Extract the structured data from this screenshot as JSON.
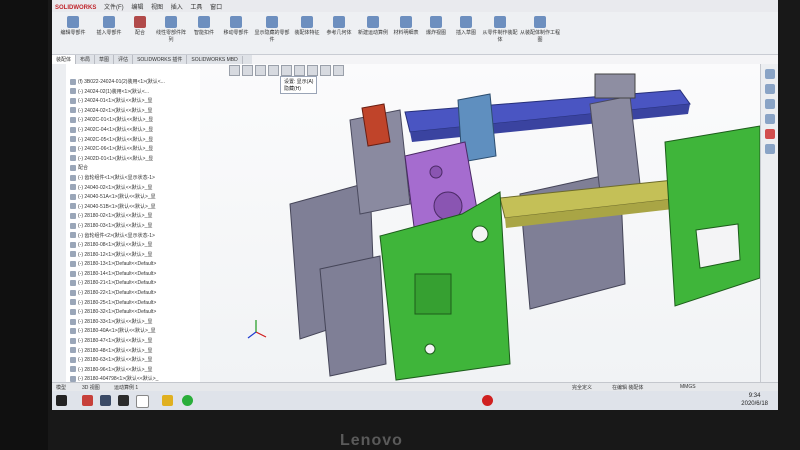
{
  "app": {
    "brand": "SOLIDWORKS",
    "menu": [
      "文件(F)",
      "编辑",
      "视图",
      "插入",
      "工具",
      "窗口"
    ]
  },
  "ribbon": {
    "groups": [
      {
        "label": "编辑零部件",
        "icon": "edit-component-icon"
      },
      {
        "label": "插入零部件",
        "icon": "insert-component-icon"
      },
      {
        "label": "配合",
        "icon": "mate-icon"
      },
      {
        "label": "线性零部件阵列",
        "icon": "pattern-icon"
      },
      {
        "label": "智能扣件",
        "icon": "fastener-icon"
      },
      {
        "label": "移动零部件",
        "icon": "move-component-icon"
      },
      {
        "label": "显示隐藏的零部件",
        "icon": "show-hidden-icon"
      },
      {
        "label": "装配体特征",
        "icon": "assembly-feature-icon"
      },
      {
        "label": "参考几何体",
        "icon": "reference-geometry-icon"
      },
      {
        "label": "新建运动算例",
        "icon": "motion-study-icon"
      },
      {
        "label": "材料明细表",
        "icon": "bom-icon"
      },
      {
        "label": "爆炸视图",
        "icon": "explode-icon"
      },
      {
        "label": "插入草图",
        "icon": "sketch-icon"
      },
      {
        "label": "从零件制作装配体",
        "icon": "make-assembly-icon"
      },
      {
        "label": "从装配体制作工程图",
        "icon": "make-drawing-icon"
      }
    ]
  },
  "tabs": [
    "装配体",
    "布局",
    "草图",
    "评估",
    "SOLIDWORKS 插件",
    "SOLIDWORKS MBD"
  ],
  "tree": {
    "rows": [
      "(f) 3B022-24024-01(2)装用<1>(默认<...",
      "(-) 24024-02(1)装用<1>(默认<...",
      "(-) 24024-01<1>(默认<<默认>_显",
      "(-) 24024-02<1>(默认<<默认>_显",
      "(-) 2402C-01<1>(默认<<默认>_显",
      "(-) 2402C-04<1>(默认<<默认>_显",
      "(-) 2402C-05<1>(默认<<默认>_显",
      "(-) 2402C-06<1>(默认<<默认>_显",
      "(-) 2402D-01<1>(默认<<默认>_显",
      "配合",
      "(-) 齿轮组件<1>(默认<显示状态-1>",
      "(-) 24040-02<1>(默认<<默认>_显",
      "(-) 24040-51A<1>(默认<<默认>_显",
      "(-) 24040-51B<1>(默认<<默认>_显",
      "(-) 28180-02<1>(默认<<默认>_显",
      "(-) 28180-03<1>(默认<<默认>_显",
      "(-) 齿轮组件<2>(默认<显示状态-1>",
      "(-) 28180-08<1>(默认<<默认>_显",
      "(-) 28180-12<1>(默认<<默认>_显",
      "(-) 28180-13<1>(Default<<Default>",
      "(-) 28180-14<1>(Default<<Default>",
      "(-) 28180-21<1>(Default<<Default>",
      "(-) 28180-22<1>(Default<<Default>",
      "(-) 28180-25<1>(Default<<Default>",
      "(-) 28180-32<1>(Default<<Default>",
      "(-) 28180-33<1>(默认<<默认>_显",
      "(-) 28180-40A<1>(默认<<默认>_显",
      "(-) 28180-47<1>(默认<<默认>_显",
      "(-) 28180-48<1>(默认<<默认>_显",
      "(-) 28180-63<1>(默认<<默认>_显",
      "(-) 28180-96<1>(默认<<默认>_显",
      "(-) 28180-404798<1>(默认<<默认>_"
    ]
  },
  "viewport": {
    "popup_line1": "设置: 显示(A)",
    "popup_line2": "隐藏(H)"
  },
  "bottom_tabs": [
    "模型",
    "3D 视图",
    "运动算例 1"
  ],
  "statusbar": {
    "left": "正在编辑: 装配体",
    "mid1": "完全定义",
    "mid2": "在编辑 装配体",
    "units": "MMGS"
  },
  "taskbar": {
    "time": "9:34",
    "date": "2020/6/18"
  },
  "monitor_brand": "Lenovo",
  "colors": {
    "green": "#3fb53a",
    "purple": "#a56ccf",
    "blue_bar": "#4a55c2",
    "grey_part": "#7f7f96",
    "olive_rail": "#c4c057",
    "orange_red": "#c0442a"
  }
}
